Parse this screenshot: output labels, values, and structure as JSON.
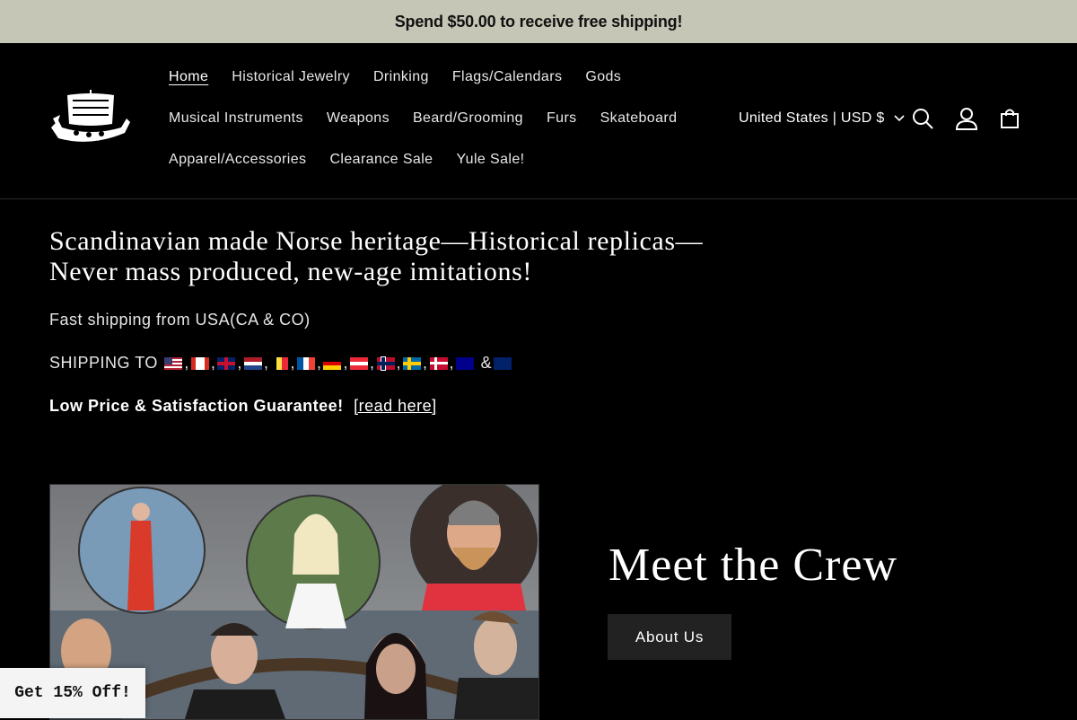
{
  "announcement": {
    "text": "Spend $50.00 to receive free shipping!"
  },
  "header": {
    "logo_icon": "viking-ship-logo-icon",
    "nav": [
      {
        "label": "Home",
        "active": true
      },
      {
        "label": "Historical Jewelry"
      },
      {
        "label": "Drinking"
      },
      {
        "label": "Flags/Calendars"
      },
      {
        "label": "Gods"
      },
      {
        "label": "Musical Instruments"
      },
      {
        "label": "Weapons"
      },
      {
        "label": "Beard/Grooming"
      },
      {
        "label": "Furs"
      },
      {
        "label": "Skateboard"
      },
      {
        "label": "Apparel/Accessories"
      },
      {
        "label": "Clearance Sale"
      },
      {
        "label": "Yule Sale!"
      }
    ],
    "country_selector": "United States | USD $",
    "icons": [
      "search-icon",
      "account-icon",
      "cart-icon"
    ]
  },
  "hero": {
    "headline_line1": "Scandinavian made Norse heritage—Historical replicas—",
    "headline_line2": "Never mass produced, new-age imitations!",
    "shipping_from": "Fast shipping from USA(CA & CO)",
    "shipping_to_label": "SHIPPING TO",
    "countries": [
      "US",
      "CA",
      "GB",
      "NL",
      "BE",
      "FR",
      "DE",
      "AT",
      "NO",
      "SE",
      "DK",
      "AU",
      "NZ"
    ],
    "guarantee": "Low Price & Satisfaction Guarantee!",
    "guarantee_link": "[read here]"
  },
  "crew": {
    "title": "Meet the Crew",
    "button": "About Us"
  },
  "popup": {
    "discount": "Get 15% Off!"
  },
  "colors": {
    "announcement_bg": "#c6c6b6",
    "page_bg": "#000000",
    "button_bg": "#222222"
  }
}
